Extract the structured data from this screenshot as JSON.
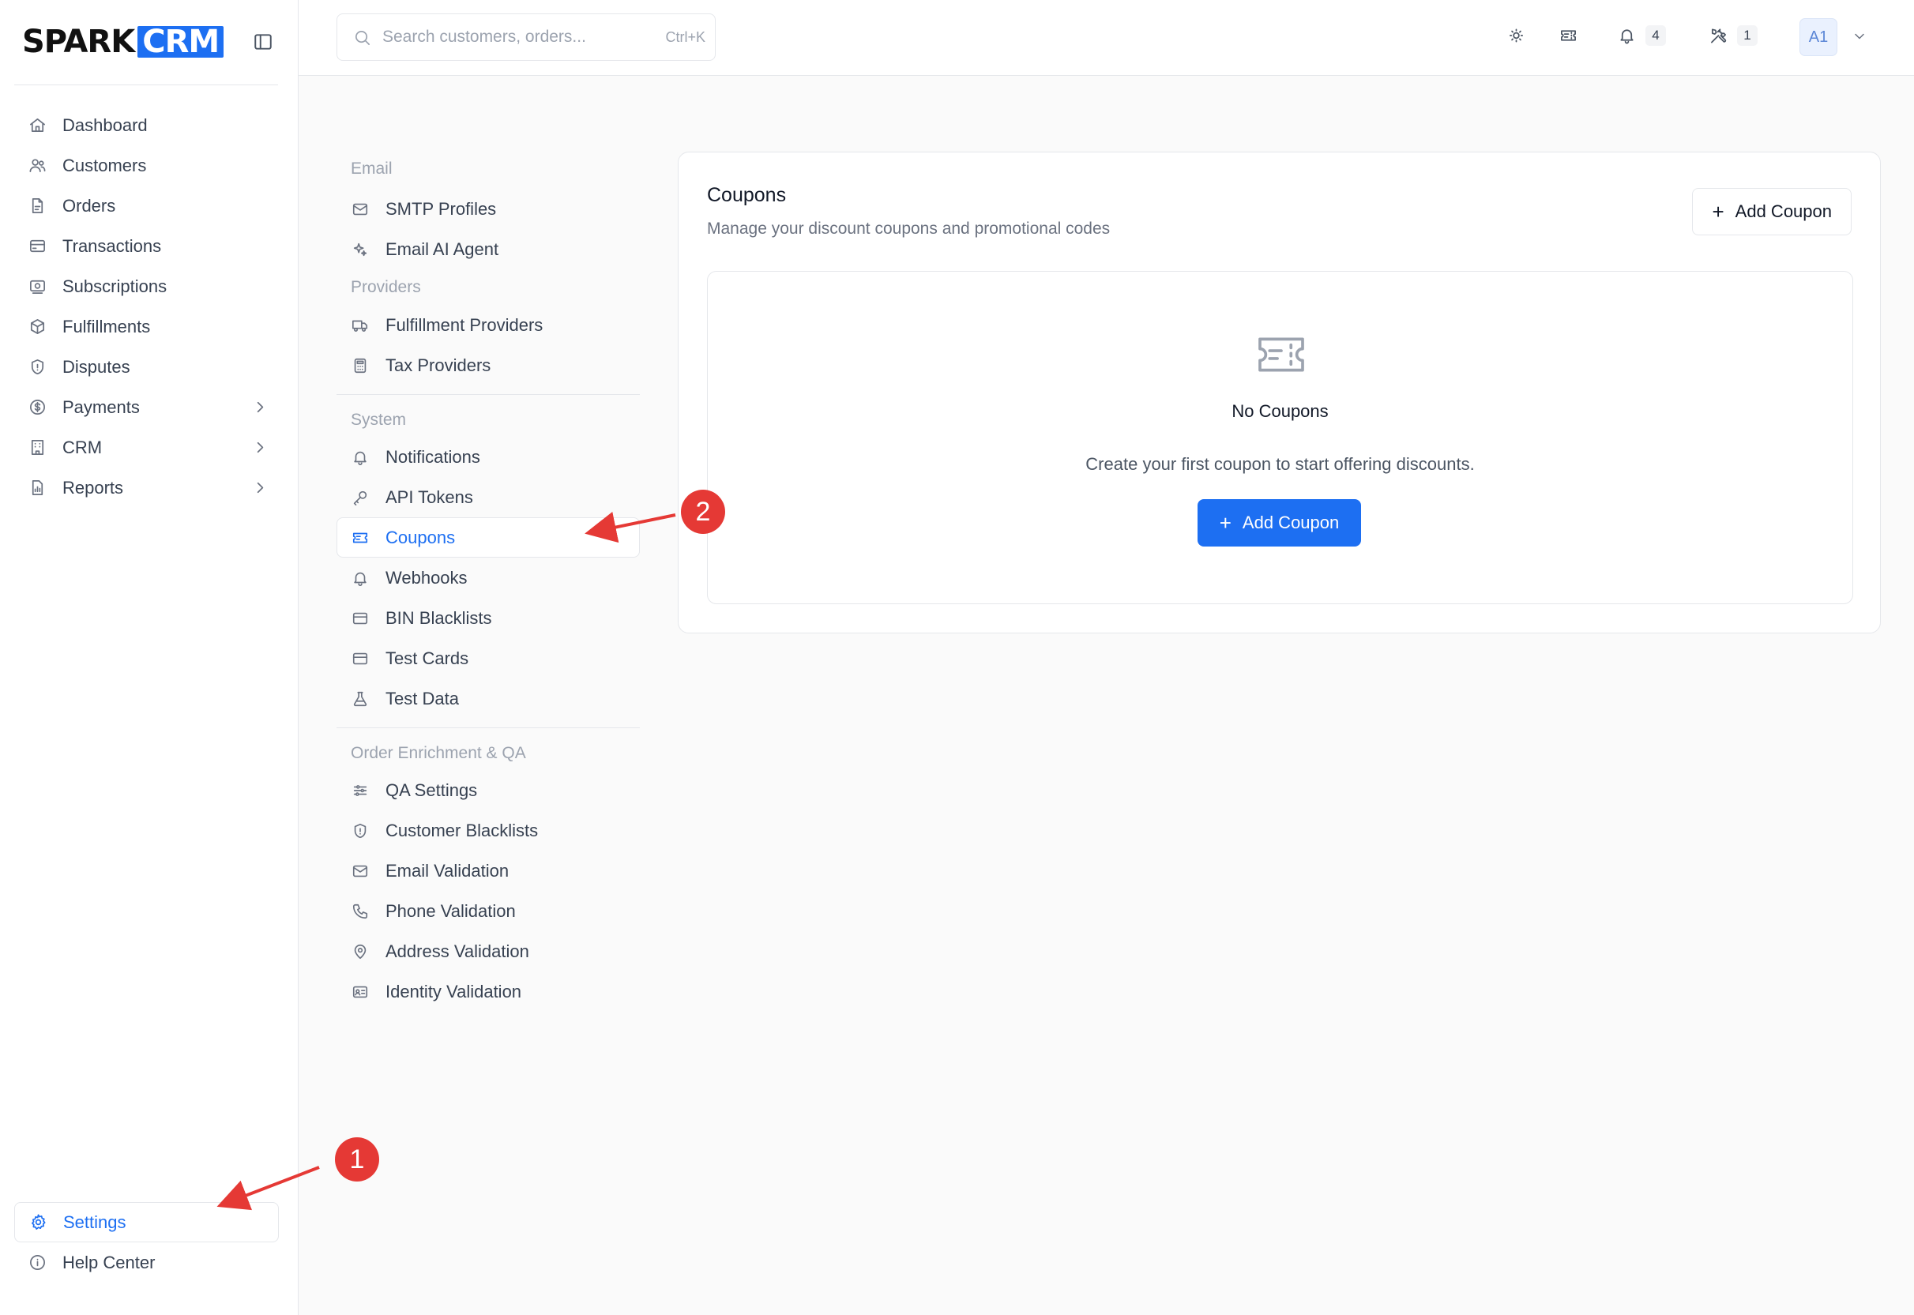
{
  "app": {
    "logo_part1": "SPARK",
    "logo_part2": "CRM",
    "accent": "#1d6ff2"
  },
  "sidebar": {
    "items": [
      {
        "label": "Dashboard",
        "icon": "home-icon"
      },
      {
        "label": "Customers",
        "icon": "users-icon"
      },
      {
        "label": "Orders",
        "icon": "file-icon"
      },
      {
        "label": "Transactions",
        "icon": "credit-card-icon"
      },
      {
        "label": "Subscriptions",
        "icon": "subscription-icon"
      },
      {
        "label": "Fulfillments",
        "icon": "box-icon"
      },
      {
        "label": "Disputes",
        "icon": "shield-icon"
      },
      {
        "label": "Payments",
        "icon": "dollar-circle-icon",
        "expandable": true
      },
      {
        "label": "CRM",
        "icon": "building-icon",
        "expandable": true
      },
      {
        "label": "Reports",
        "icon": "report-icon",
        "expandable": true
      }
    ],
    "bottom": [
      {
        "label": "Settings",
        "icon": "gear-icon",
        "active": true
      },
      {
        "label": "Help Center",
        "icon": "info-icon"
      }
    ]
  },
  "topbar": {
    "search_placeholder": "Search customers, orders...",
    "search_shortcut": "Ctrl+K",
    "notifications_count": "4",
    "tools_count": "1",
    "avatar_initials": "A1"
  },
  "settings_nav": {
    "sections": [
      {
        "title": "Email",
        "items": [
          {
            "label": "SMTP Profiles",
            "icon": "mail-icon"
          },
          {
            "label": "Email AI Agent",
            "icon": "sparkles-icon"
          }
        ]
      },
      {
        "title": "Providers",
        "items": [
          {
            "label": "Fulfillment Providers",
            "icon": "truck-icon"
          },
          {
            "label": "Tax Providers",
            "icon": "calculator-icon"
          }
        ]
      },
      {
        "title": "System",
        "items": [
          {
            "label": "Notifications",
            "icon": "bell-icon"
          },
          {
            "label": "API Tokens",
            "icon": "key-icon"
          },
          {
            "label": "Coupons",
            "icon": "ticket-icon",
            "active": true
          },
          {
            "label": "Webhooks",
            "icon": "bell-icon"
          },
          {
            "label": "BIN Blacklists",
            "icon": "credit-card-icon"
          },
          {
            "label": "Test Cards",
            "icon": "credit-card-icon"
          },
          {
            "label": "Test Data",
            "icon": "flask-icon"
          }
        ]
      },
      {
        "title": "Order Enrichment & QA",
        "items": [
          {
            "label": "QA Settings",
            "icon": "sliders-icon"
          },
          {
            "label": "Customer Blacklists",
            "icon": "shield-icon"
          },
          {
            "label": "Email Validation",
            "icon": "mail-icon"
          },
          {
            "label": "Phone Validation",
            "icon": "phone-icon"
          },
          {
            "label": "Address Validation",
            "icon": "map-pin-icon"
          },
          {
            "label": "Identity Validation",
            "icon": "id-card-icon"
          }
        ]
      }
    ]
  },
  "coupons": {
    "title": "Coupons",
    "subtitle": "Manage your discount coupons and promotional codes",
    "add_button": "Add Coupon",
    "empty_title": "No Coupons",
    "empty_desc": "Create your first coupon to start offering discounts.",
    "empty_button": "Add Coupon"
  },
  "annotations": {
    "marker1": "1",
    "marker2": "2",
    "color": "#e53935"
  }
}
